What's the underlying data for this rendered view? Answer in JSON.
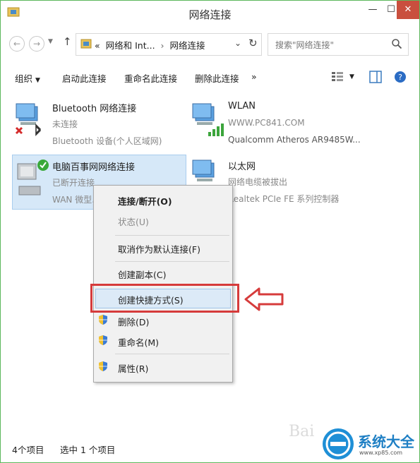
{
  "window": {
    "title": "网络连接",
    "min_label": "—",
    "max_label": "☐",
    "close_label": "✕"
  },
  "address": {
    "path_prefix": "«",
    "path_1": "网络和 Int...",
    "path_2": "网络连接",
    "sep": "›",
    "search_placeholder": "搜索\"网络连接\""
  },
  "commands": {
    "organize": "组织",
    "start_connection": "启动此连接",
    "rename_connection": "重命名此连接",
    "delete_connection": "删除此连接",
    "more": "»"
  },
  "connections": [
    {
      "name": "Bluetooth 网络连接",
      "status": "未连接",
      "device": "Bluetooth 设备(个人区域网)"
    },
    {
      "name": "WLAN",
      "status": "WWW.PC841.COM",
      "device": "Qualcomm Atheros AR9485W..."
    },
    {
      "name": "电脑百事网网络连接",
      "status": "已断开连接",
      "device": "WAN 微型..."
    },
    {
      "name": "以太网",
      "status": "网络电缆被拔出",
      "device": "Realtek PCIe FE 系列控制器"
    }
  ],
  "context_menu": [
    {
      "label": "连接/断开(O)"
    },
    {
      "label": "状态(U)"
    },
    {
      "label": "取消作为默认连接(F)"
    },
    {
      "label": "创建副本(C)"
    },
    {
      "label": "创建快捷方式(S)"
    },
    {
      "label": "删除(D)"
    },
    {
      "label": "重命名(M)"
    },
    {
      "label": "属性(R)"
    }
  ],
  "status_bar": {
    "item_count": "4个项目",
    "selected": "选中 1 个项目"
  },
  "branding": {
    "logo_text": "系统大全",
    "logo_url": "www.xp85.com",
    "watermark": "Bai"
  },
  "colors": {
    "highlight_red": "#d63b3b",
    "selection_blue": "#d6e8f8",
    "close_red": "#c94f3e"
  }
}
